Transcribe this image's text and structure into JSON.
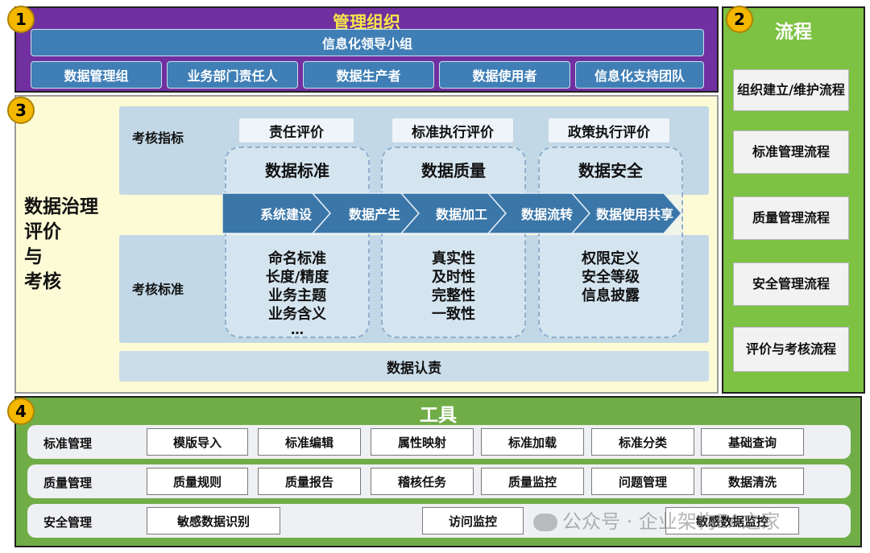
{
  "badges": [
    "1",
    "2",
    "3",
    "4"
  ],
  "org": {
    "title": "管理组织",
    "leader": "信息化领导小组",
    "members": [
      "数据管理组",
      "业务部门责任人",
      "数据生产者",
      "数据使用者",
      "信息化支持团队"
    ]
  },
  "process": {
    "title": "流程",
    "items": [
      "组织建立/维护流程",
      "标准管理流程",
      "质量管理流程",
      "安全管理流程",
      "评价与考核流程"
    ]
  },
  "evaluation": {
    "side_title": [
      "数据治理",
      "评价",
      "与",
      "考核"
    ],
    "indicator_label": "考核指标",
    "standard_label": "考核标准",
    "indicators": [
      "责任评价",
      "标准执行评价",
      "政策执行评价"
    ],
    "columns": [
      {
        "title": "数据标准",
        "items": [
          "命名标准",
          "长度/精度",
          "业务主题",
          "业务含义"
        ]
      },
      {
        "title": "数据质量",
        "items": [
          "真实性",
          "及时性",
          "完整性",
          "一致性"
        ]
      },
      {
        "title": "数据安全",
        "items": [
          "权限定义",
          "安全等级",
          "信息披露"
        ]
      }
    ],
    "ellipsis": "…",
    "flow": [
      "系统建设",
      "数据产生",
      "数据加工",
      "数据流转",
      "数据使用共享"
    ],
    "bottom": "数据认责"
  },
  "tools": {
    "title": "工具",
    "rows": [
      {
        "label": "标准管理",
        "items": [
          "模版导入",
          "标准编辑",
          "属性映射",
          "标准加载",
          "标准分类",
          "基础查询"
        ]
      },
      {
        "label": "质量管理",
        "items": [
          "质量规则",
          "质量报告",
          "稽核任务",
          "质量监控",
          "问题管理",
          "数据清洗"
        ]
      },
      {
        "label": "安全管理",
        "items": [
          "敏感数据识别",
          "访问监控",
          "敏感数据监控"
        ]
      }
    ]
  },
  "watermark": "公众号 · 企业架构EA之家"
}
